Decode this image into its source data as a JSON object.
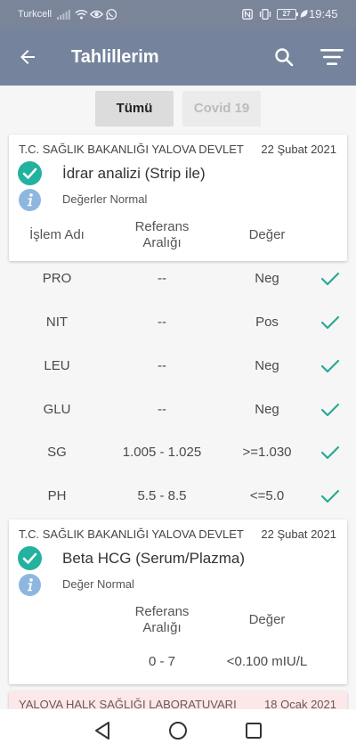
{
  "status_bar": {
    "carrier": "Turkcell",
    "battery_level": "27",
    "time": "19:45",
    "icons_left": [
      "signal-icon",
      "wifi-icon",
      "eye-icon",
      "whatsapp-icon"
    ],
    "icons_right": [
      "nfc-icon",
      "vibrate-icon",
      "battery-icon",
      "leaf-icon"
    ]
  },
  "app_bar": {
    "title": "Tahlillerim",
    "left_icon": "arrow-back-icon",
    "right_icons": [
      "search-icon",
      "filter-icon"
    ]
  },
  "tabs": [
    {
      "label": "Tümü",
      "selected": true
    },
    {
      "label": "Covid 19",
      "selected": false
    }
  ],
  "results": [
    {
      "institution": "T.C. SAĞLIK BAKANLIĞI YALOVA DEVLET",
      "date": "22 Şubat 2021",
      "test_name": "İdrar analizi (Strip ile)",
      "status_icon": "check-circle-icon",
      "info_icon": "info-icon",
      "summary": "Değerler Normal",
      "columns": {
        "name": "İşlem Adı",
        "reference": "Referans Aralığı",
        "value": "Değer"
      },
      "rows": [
        {
          "name": "PRO",
          "reference": "--",
          "value": "Neg",
          "icon": "check-icon"
        },
        {
          "name": "NIT",
          "reference": "--",
          "value": "Pos",
          "icon": "check-icon"
        },
        {
          "name": "LEU",
          "reference": "--",
          "value": "Neg",
          "icon": "check-icon"
        },
        {
          "name": "GLU",
          "reference": "--",
          "value": "Neg",
          "icon": "check-icon"
        },
        {
          "name": "SG",
          "reference": "1.005 - 1.025",
          "value": ">=1.030",
          "icon": "check-icon"
        },
        {
          "name": "PH",
          "reference": "5.5 - 8.5",
          "value": "<=5.0",
          "icon": "check-icon"
        }
      ]
    },
    {
      "institution": "T.C. SAĞLIK BAKANLIĞI YALOVA DEVLET",
      "date": "22 Şubat 2021",
      "test_name": "Beta HCG (Serum/Plazma)",
      "status_icon": "check-circle-icon",
      "info_icon": "info-icon",
      "summary": "Değer Normal",
      "columns": {
        "reference": "Referans Aralığı",
        "value": "Değer"
      },
      "rows": [
        {
          "reference": "0 - 7",
          "value": "<0.100 mIU/L"
        }
      ]
    },
    {
      "institution": "YALOVA HALK SAĞLIĞI LABORATUVARI",
      "date": "18 Ocak 2021"
    }
  ],
  "nav_bar": {
    "icons": [
      "nav-back-icon",
      "nav-home-icon",
      "nav-recents-icon"
    ]
  },
  "colors": {
    "app_bar": "#75849c",
    "accent_green": "#22b29f",
    "info_blue": "#8eb7df",
    "highlight_card": "#fde8e9"
  }
}
